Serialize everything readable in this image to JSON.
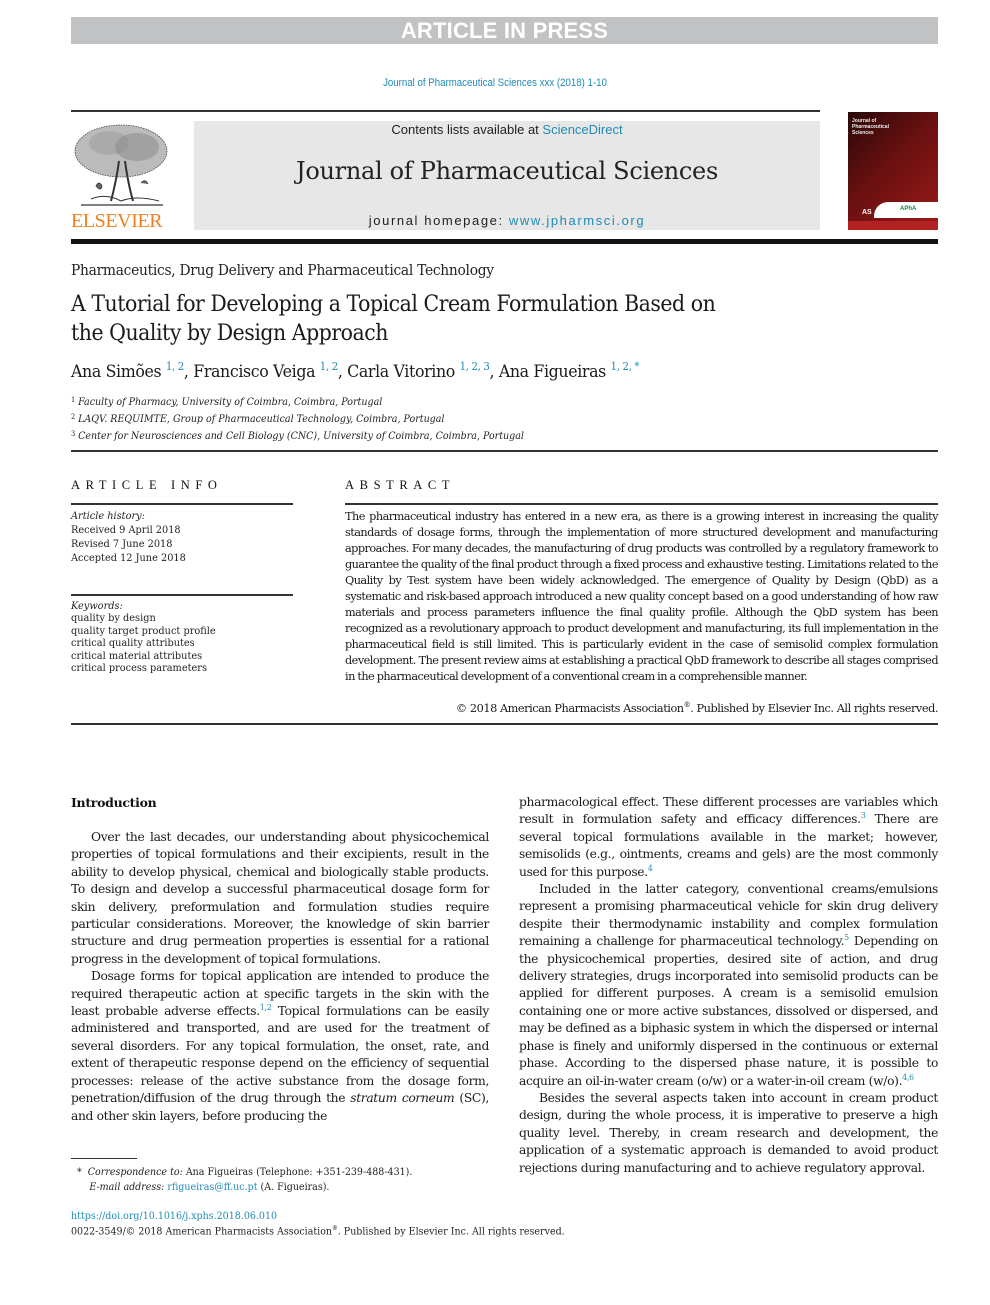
{
  "banner": {
    "text": "ARTICLE IN PRESS"
  },
  "journal_ref": "Journal of Pharmaceutical Sciences xxx (2018) 1-10",
  "header": {
    "publisher_logo": "ELSEVIER",
    "contents_prefix": "Contents lists available at ",
    "contents_link": "ScienceDirect",
    "journal_title": "Journal of Pharmaceutical Sciences",
    "homepage_prefix": "journal homepage: ",
    "homepage_link": "www.jpharmsci.org",
    "cover": {
      "title_lines": [
        "Journal of",
        "Pharmaceutical",
        "Sciences"
      ],
      "publisher_mark": "APhA"
    }
  },
  "section": "Pharmaceutics, Drug Delivery and Pharmaceutical Technology",
  "title": "A Tutorial for Developing a Topical Cream Formulation Based on the Quality by Design Approach",
  "authors": [
    {
      "name": "Ana Simões",
      "affils": "1, 2"
    },
    {
      "name": "Francisco Veiga",
      "affils": "1, 2"
    },
    {
      "name": "Carla Vitorino",
      "affils": "1, 2, 3"
    },
    {
      "name": "Ana Figueiras",
      "affils": "1, 2, *"
    }
  ],
  "affiliations": [
    {
      "num": "1",
      "text": "Faculty of Pharmacy, University of Coimbra, Coimbra, Portugal"
    },
    {
      "num": "2",
      "text": "LAQV. REQUIMTE, Group of Pharmaceutical Technology, Coimbra, Portugal"
    },
    {
      "num": "3",
      "text": "Center for Neurosciences and Cell Biology (CNC), University of Coimbra, Coimbra, Portugal"
    }
  ],
  "article_info": {
    "heading": "ARTICLE INFO",
    "history_label": "Article history:",
    "history": [
      "Received 9 April 2018",
      "Revised 7 June 2018",
      "Accepted 12 June 2018"
    ],
    "keywords_label": "Keywords:",
    "keywords": [
      "quality by design",
      "quality target product profile",
      "critical quality attributes",
      "critical material attributes",
      "critical process parameters"
    ]
  },
  "abstract": {
    "heading": "ABSTRACT",
    "text": "The pharmaceutical industry has entered in a new era, as there is a growing interest in increasing the quality standards of dosage forms, through the implementation of more structured development and manufacturing approaches. For many decades, the manufacturing of drug products was controlled by a regulatory framework to guarantee the quality of the final product through a fixed process and exhaustive testing. Limitations related to the Quality by Test system have been widely acknowledged. The emergence of Quality by Design (QbD) as a systematic and risk-based approach introduced a new quality concept based on a good understanding of how raw materials and process parameters influence the final quality profile. Although the QbD system has been recognized as a revolutionary approach to product development and manufacturing, its full implementation in the pharmaceutical field is still limited. This is particularly evident in the case of semisolid complex formulation development. The present review aims at establishing a practical QbD framework to describe all stages comprised in the pharmaceutical development of a conventional cream in a comprehensible manner.",
    "copyright_pre": "© 2018 American Pharmacists Association",
    "copyright_reg": "®",
    "copyright_post": ". Published by Elsevier Inc. All rights reserved."
  },
  "body": {
    "intro_heading": "Introduction",
    "left": {
      "p1": "Over the last decades, our understanding about physicochemical properties of topical formulations and their excipients, result in the ability to develop physical, chemical and biologically stable products. To design and develop a successful pharmaceutical dosage form for skin delivery, preformulation and formulation studies require particular considerations. Moreover, the knowledge of skin barrier structure and drug permeation properties is essential for a rational progress in the development of topical formulations.",
      "p2a": "Dosage forms for topical application are intended to produce the required therapeutic action at specific targets in the skin with the least probable adverse effects.",
      "p2_ref": "1,2",
      "p2b": " Topical formulations can be easily administered and transported, and are used for the treatment of several disorders. For any topical formulation, the onset, rate, and extent of therapeutic response depend on the efficiency of sequential processes: release of the active substance from the dosage form, penetration/diffusion of the drug through the ",
      "p2_it1": "stratum corneum",
      "p2c": " (SC), and other skin layers, before producing the"
    },
    "right": {
      "p1a": "pharmacological effect. These different processes are variables which result in formulation safety and efficacy differences.",
      "p1_ref1": "3",
      "p1b": " There are several topical formulations available in the market; however, semisolids (e.g., ointments, creams and gels) are the most commonly used for this purpose.",
      "p1_ref2": "4",
      "p2a": "Included in the latter category, conventional creams/emulsions represent a promising pharmaceutical vehicle for skin drug delivery despite their thermodynamic instability and complex formulation remaining a challenge for pharmaceutical technology.",
      "p2_ref1": "5",
      "p2b": " Depending on the physicochemical properties, desired site of action, and drug delivery strategies, drugs incorporated into semisolid products can be applied for different purposes. A cream is a semisolid emulsion containing one or more active substances, dissolved or dispersed, and may be defined as a biphasic system in which the dispersed or internal phase is finely and uniformly dispersed in the continuous or external phase. According to the dispersed phase nature, it is possible to acquire an oil-in-water cream (o/w) or a water-in-oil cream (w/o).",
      "p2_ref2": "4,6",
      "p3": "Besides the several aspects taken into account in cream product design, during the whole process, it is imperative to preserve a high quality level. Thereby, in cream research and development, the application of a systematic approach is demanded to avoid product rejections during manufacturing and to achieve regulatory approval."
    }
  },
  "footnote": {
    "star": "*",
    "corr_label": "Correspondence to:",
    "corr_text": " Ana Figueiras (Telephone: +351-239-488-431).",
    "email_label": "E-mail address:",
    "email": "rfigueiras@ff.uc.pt",
    "email_suffix": " (A. Figueiras)."
  },
  "doi": "https://doi.org/10.1016/j.xphs.2018.06.010",
  "issn_pre": "0022-3549/© 2018 American Pharmacists Association",
  "issn_reg": "®",
  "issn_post": ". Published by Elsevier Inc. All rights reserved.",
  "colors": {
    "link": "#1f8bb5",
    "banner": "#c1c2c3",
    "masthead": "#e7e7e7",
    "elsevier_orange": "#f07f1d"
  }
}
